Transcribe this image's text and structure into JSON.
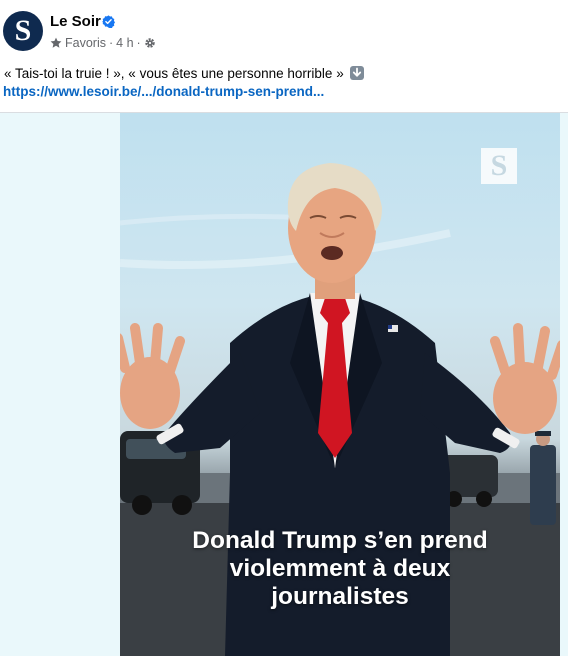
{
  "post": {
    "page_name": "Le Soir",
    "avatar_letter": "S",
    "meta": {
      "audience": "Favoris",
      "separator": "·",
      "time": "4 h"
    },
    "text": "« Tais-toi la truie ! », « vous êtes une personne horrible »",
    "link": "https://www.lesoir.be/.../donald-trump-sen-prend..."
  },
  "media": {
    "logo": "S",
    "caption_lines": [
      "Donald Trump s’en prend",
      "violemment à deux",
      "journalistes"
    ]
  },
  "colors": {
    "link": "#0a66c2",
    "verified": "#1877f2",
    "avatar_bg": "#0f2a4f"
  }
}
